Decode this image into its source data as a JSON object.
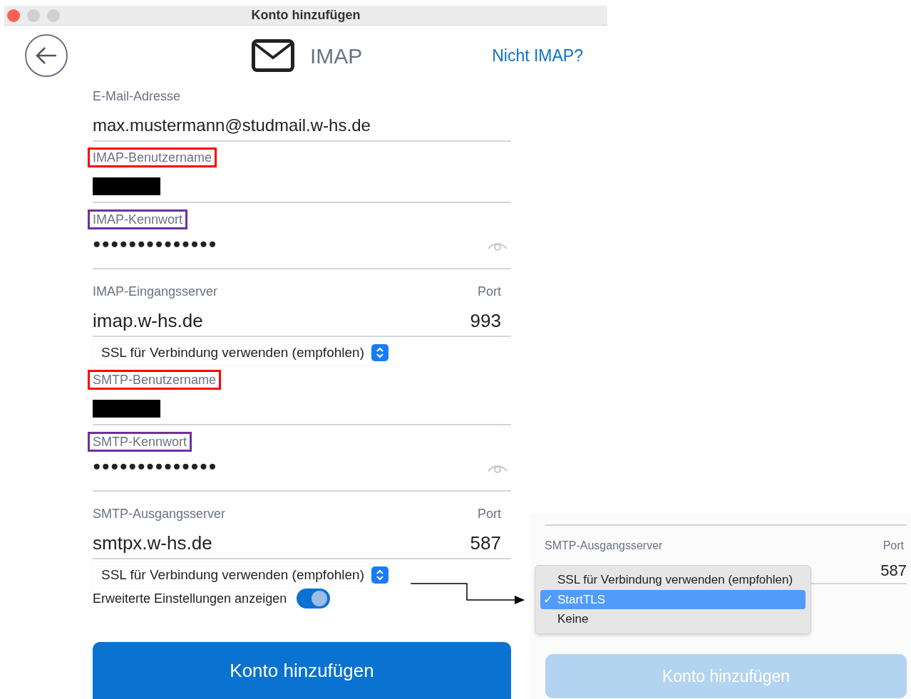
{
  "window": {
    "title": "Konto hinzufügen"
  },
  "header": {
    "protocol": "IMAP",
    "link": "Nicht IMAP?"
  },
  "fields": [
    {
      "kind": "text",
      "label": "E-Mail-Adresse",
      "value": "max.mustermann@studmail.w-hs.de"
    },
    {
      "kind": "redacted",
      "label": "IMAP-Benutzername",
      "color": "#ff0000"
    },
    {
      "kind": "password",
      "label": "IMAP-Kennwort",
      "value": "●●●●●●●●●●●●●●",
      "color": "#7030a0"
    },
    {
      "kind": "server",
      "label": "IMAP-Eingangsserver",
      "value": "imap.w-hs.de",
      "port_label": "Port",
      "port": "993"
    },
    {
      "kind": "select",
      "value": "SSL für Verbindung verwenden (empfohlen)"
    },
    {
      "kind": "redacted",
      "label": "SMTP-Benutzername",
      "color": "#ff0000"
    },
    {
      "kind": "password",
      "label": "SMTP-Kennwort",
      "value": "●●●●●●●●●●●●●●",
      "color": "#7030a0"
    },
    {
      "kind": "server",
      "label": "SMTP-Ausgangsserver",
      "value": "smtpx.w-hs.de",
      "port_label": "Port",
      "port": "587"
    },
    {
      "kind": "select",
      "value": "SSL für Verbindung verwenden (empfohlen)"
    }
  ],
  "toggle": {
    "label": "Erweiterte Einstellungen anzeigen",
    "on": true
  },
  "button": {
    "label": "Konto hinzufügen",
    "disabled": false
  },
  "inset": {
    "server_label": "SMTP-Ausgangsserver",
    "port_label": "Port",
    "port": "587",
    "menu": [
      {
        "label": "SSL für Verbindung verwenden (empfohlen)",
        "selected": false
      },
      {
        "label": "StartTLS",
        "selected": true,
        "check": "✓"
      },
      {
        "label": "Keine",
        "selected": false
      }
    ],
    "button": {
      "label": "Konto hinzufügen",
      "disabled": true
    }
  }
}
